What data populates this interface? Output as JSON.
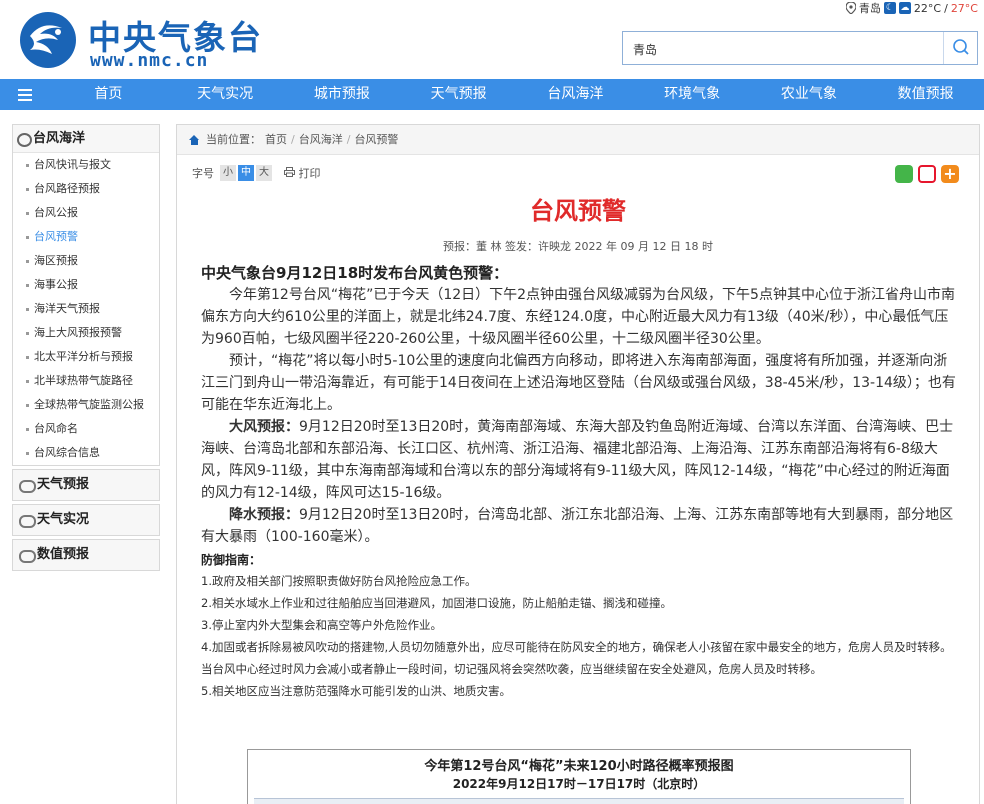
{
  "header": {
    "site_name": "中央气象台",
    "site_url": "www.nmc.cn",
    "location": "青岛",
    "temp_low": "22°C",
    "temp_sep": "/",
    "temp_high": "27°C",
    "search_value": "青岛"
  },
  "nav": [
    "首页",
    "天气实况",
    "城市预报",
    "天气预报",
    "台风海洋",
    "环境气象",
    "农业气象",
    "数值预报"
  ],
  "sidebar": {
    "section_title": "台风海洋",
    "items": [
      {
        "label": "台风快讯与报文",
        "active": false
      },
      {
        "label": "台风路径预报",
        "active": false
      },
      {
        "label": "台风公报",
        "active": false
      },
      {
        "label": "台风预警",
        "active": true
      },
      {
        "label": "海区预报",
        "active": false
      },
      {
        "label": "海事公报",
        "active": false
      },
      {
        "label": "海洋天气预报",
        "active": false
      },
      {
        "label": "海上大风预报预警",
        "active": false
      },
      {
        "label": "北太平洋分析与预报",
        "active": false
      },
      {
        "label": "北半球热带气旋路径",
        "active": false
      },
      {
        "label": "全球热带气旋监测公报",
        "active": false
      },
      {
        "label": "台风命名",
        "active": false
      },
      {
        "label": "台风综合信息",
        "active": false
      }
    ],
    "groups": [
      "天气预报",
      "天气实况",
      "数值预报"
    ]
  },
  "breadcrumb": {
    "label": "当前位置：",
    "items": [
      "首页",
      "台风海洋",
      "台风预警"
    ],
    "separator": "/"
  },
  "toolbar": {
    "font_label": "字号",
    "small": "小",
    "medium": "中",
    "large": "大",
    "print": "打印"
  },
  "article": {
    "title": "台风预警",
    "meta": "预报：董 林 签发：许映龙 2022 年 09 月 12 日 18 时",
    "headline": "中央气象台9月12日18时发布台风黄色预警：",
    "para1": "今年第12号台风“梅花”已于今天（12日）下午2点钟由强台风级减弱为台风级，下午5点钟其中心位于浙江省舟山市南偏东方向大约610公里的洋面上，就是北纬24.7度、东经124.0度，中心附近最大风力有13级（40米/秒），中心最低气压为960百帕，七级风圈半径220-260公里，十级风圈半径60公里，十二级风圈半径30公里。",
    "para2": "预计，“梅花”将以每小时5-10公里的速度向北偏西方向移动，即将进入东海南部海面，强度将有所加强，并逐渐向浙江三门到舟山一带沿海靠近，有可能于14日夜间在上述沿海地区登陆（台风级或强台风级，38-45米/秒，13-14级）；也有可能在华东近海北上。",
    "wind_label": "大风预报：",
    "wind_text": "9月12日20时至13日20时，黄海南部海域、东海大部及钓鱼岛附近海域、台湾以东洋面、台湾海峡、巴士海峡、台湾岛北部和东部沿海、长江口区、杭州湾、浙江沿海、福建北部沿海、上海沿海、江苏东南部沿海将有6-8级大风，阵风9-11级，其中东海南部海域和台湾以东的部分海域将有9-11级大风，阵风12-14级，“梅花”中心经过的附近海面的风力有12-14级，阵风可达15-16级。",
    "rain_label": "降水预报：",
    "rain_text": "9月12日20时至13日20时，台湾岛北部、浙江东北部沿海、上海、江苏东南部等地有大到暴雨，部分地区有大暴雨（100-160毫米）。",
    "guide_title": "防御指南：",
    "guides": [
      "1.政府及相关部门按照职责做好防台风抢险应急工作。",
      "2.相关水域水上作业和过往船舶应当回港避风，加固港口设施，防止船舶走锚、搁浅和碰撞。",
      "3.停止室内外大型集会和高空等户外危险作业。",
      "4.加固或者拆除易被风吹动的搭建物,人员切勿随意外出，应尽可能待在防风安全的地方，确保老人小孩留在家中最安全的地方，危房人员及时转移。当台风中心经过时风力会减小或者静止一段时间，切记强风将会突然吹袭，应当继续留在安全处避风，危房人员及时转移。",
      "5.相关地区应当注意防范强降水可能引发的山洪、地质灾害。"
    ],
    "figure_title": "今年第12号台风“梅花”未来120小时路径概率预报图",
    "figure_subtitle": "2022年9月12日17时－17日17时（北京时）"
  },
  "colors": {
    "brand": "#1a64b6",
    "nav": "#3a8ee6",
    "title": "#e02a2a",
    "temp_high": "#e0463c"
  }
}
